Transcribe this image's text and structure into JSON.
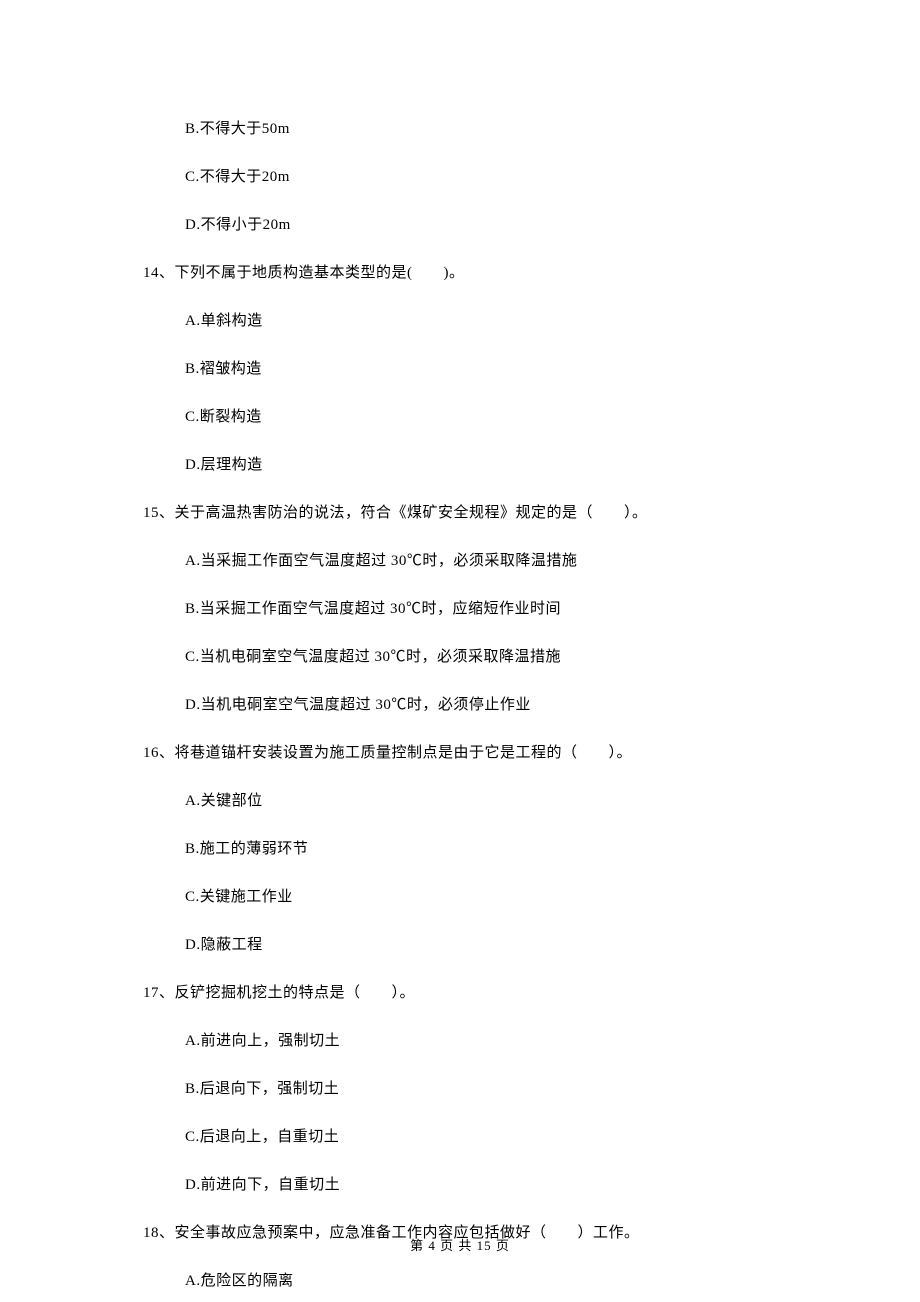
{
  "q13": {
    "options": {
      "B": "B.不得大于50m",
      "C": "C.不得大于20m",
      "D": "D.不得小于20m"
    }
  },
  "q14": {
    "text": "14、下列不属于地质构造基本类型的是(　　)。",
    "options": {
      "A": "A.单斜构造",
      "B": "B.褶皱构造",
      "C": "C.断裂构造",
      "D": "D.层理构造"
    }
  },
  "q15": {
    "text": "15、关于高温热害防治的说法，符合《煤矿安全规程》规定的是（　　）。",
    "options": {
      "A": "A.当采掘工作面空气温度超过 30℃时，必须采取降温措施",
      "B": "B.当采掘工作面空气温度超过 30℃时，应缩短作业时间",
      "C": "C.当机电硐室空气温度超过 30℃时，必须采取降温措施",
      "D": "D.当机电硐室空气温度超过 30℃时，必须停止作业"
    }
  },
  "q16": {
    "text": "16、将巷道锚杆安装设置为施工质量控制点是由于它是工程的（　　）。",
    "options": {
      "A": "A.关键部位",
      "B": "B.施工的薄弱环节",
      "C": "C.关键施工作业",
      "D": "D.隐蔽工程"
    }
  },
  "q17": {
    "text": "17、反铲挖掘机挖土的特点是（　　）。",
    "options": {
      "A": "A.前进向上，强制切土",
      "B": "B.后退向下，强制切土",
      "C": "C.后退向上，自重切土",
      "D": "D.前进向下，自重切土"
    }
  },
  "q18": {
    "text": "18、安全事故应急预案中，应急准备工作内容应包括做好（　　）工作。",
    "options": {
      "A": "A.危险区的隔离"
    }
  },
  "footer": "第 4 页 共 15 页"
}
